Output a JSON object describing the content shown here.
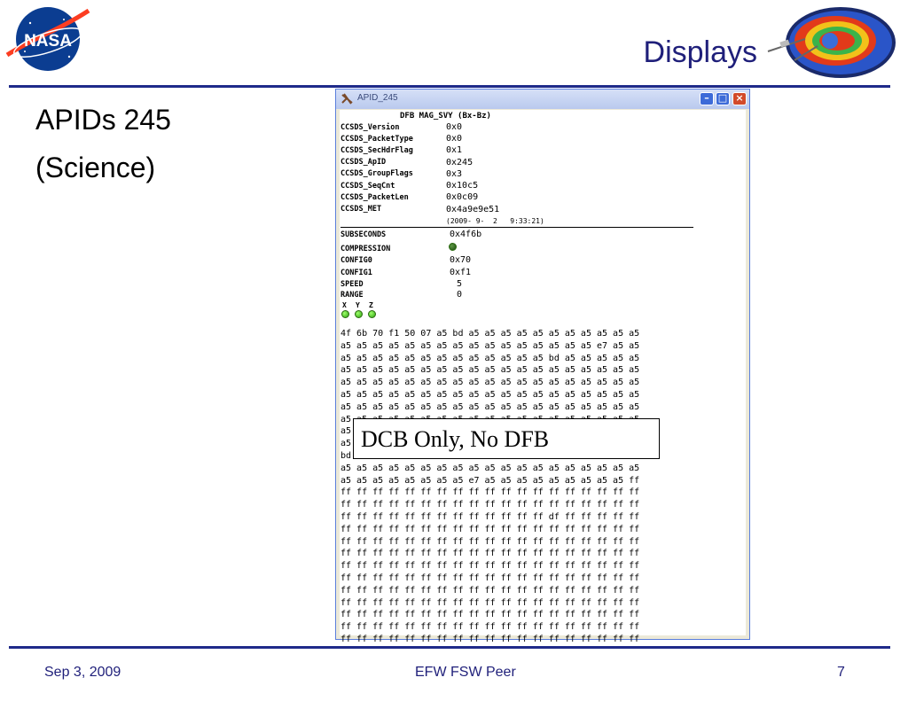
{
  "slide": {
    "title": "Displays",
    "bullets": [
      "APIDs 245",
      "(Science)"
    ],
    "footer": {
      "date": "Sep 3, 2009",
      "center": "EFW FSW Peer",
      "page": "7"
    },
    "logo_text": "NASA"
  },
  "window": {
    "title": "APID_245",
    "header": "DFB MAG_SVY (Bx-Bz)",
    "fields": [
      {
        "label": "CCSDS_Version",
        "value": "0x0"
      },
      {
        "label": "CCSDS_PacketType",
        "value": "0x0"
      },
      {
        "label": "CCSDS_SecHdrFlag",
        "value": "0x1"
      },
      {
        "label": "CCSDS_ApID",
        "value": "0x245"
      },
      {
        "label": "CCSDS_GroupFlags",
        "value": "0x3"
      },
      {
        "label": "CCSDS_SeqCnt",
        "value": "0x10c5"
      },
      {
        "label": "CCSDS_PacketLen",
        "value": "0x0c09"
      },
      {
        "label": "CCSDS_MET",
        "value": "0x4a9e9e51"
      }
    ],
    "met_time": "(2009- 9-  2   9:33:21)",
    "subseconds": {
      "label": "SUBSECONDS",
      "value": "0x4f6b"
    },
    "compression": {
      "label": "COMPRESSION"
    },
    "config0": {
      "label": "CONFIG0",
      "value": "0x70"
    },
    "config1": {
      "label": "CONFIG1",
      "value": "0xf1"
    },
    "speed": {
      "label": "SPEED",
      "value": "5"
    },
    "range": {
      "label": "RANGE",
      "value": "0"
    },
    "axes": [
      "X",
      "Y",
      "Z"
    ],
    "hexdump": "4f 6b 70 f1 50 07 a5 bd a5 a5 a5 a5 a5 a5 a5 a5 a5 a5 a5\na5 a5 a5 a5 a5 a5 a5 a5 a5 a5 a5 a5 a5 a5 a5 a5 e7 a5 a5\na5 a5 a5 a5 a5 a5 a5 a5 a5 a5 a5 a5 a5 bd a5 a5 a5 a5 a5\na5 a5 a5 a5 a5 a5 a5 a5 a5 a5 a5 a5 a5 a5 a5 a5 a5 a5 a5\na5 a5 a5 a5 a5 a5 a5 a5 a5 a5 a5 a5 a5 a5 a5 a5 a5 a5 a5\na5 a5 a5 a5 a5 a5 a5 a5 a5 a5 a5 a5 a5 a5 a5 a5 a5 a5 a5\na5 a5 a5 a5 a5 a5 a5 a5 a5 a5 a5 a5 a5 a5 a5 a5 a5 a5 a5\na5 a5 a5 a5 a5 a5 a5 a5 a5 a5 a5 a5 a5 a5 a5 a5 a5 a5 a5\na5 a5 a5 a5 a5 a5 a5 a5 a5 a5 a5 a5 a5 a5 a5 a5 a5 a5 a5\na5 a5 a5 a5 a5 a5 a5 a5 a5 a5 a5 a5 a5 a5 a5 a5 a5 a5 a5\nbd a5 a5 a5 a5 a5 a5 a5 a5 a5 a5 a5 a5 a5 a5 a5 a5 a5 a5\na5 a5 a5 a5 a5 a5 a5 a5 a5 a5 a5 a5 a5 a5 a5 a5 a5 a5 a5\na5 a5 a5 a5 a5 a5 a5 a5 e7 a5 a5 a5 a5 a5 a5 a5 a5 a5 ff\nff ff ff ff ff ff ff ff ff ff ff ff ff ff ff ff ff ff ff\nff ff ff ff ff ff ff ff ff ff ff ff ff ff ff ff ff ff ff\nff ff ff ff ff ff ff ff ff ff ff ff ff df ff ff ff ff ff\nff ff ff ff ff ff ff ff ff ff ff ff ff ff ff ff ff ff ff\nff ff ff ff ff ff ff ff ff ff ff ff ff ff ff ff ff ff ff\nff ff ff ff ff ff ff ff ff ff ff ff ff ff ff ff ff ff ff\nff ff ff ff ff ff ff ff ff ff ff ff ff ff ff ff ff ff ff\nff ff ff ff ff ff ff ff ff ff ff ff ff ff ff ff ff ff ff\nff ff ff ff ff ff ff ff ff ff ff ff ff ff ff ff ff ff ff\nff ff ff ff ff ff ff ff ff ff ff ff ff ff ff ff ff ff ff\nff ff ff ff ff ff ff ff ff ff ff ff ff ff ff ff ff ff ff\nff ff ff ff ff ff ff ff ff ff ff ff ff ff ff ff ff ff ff\nff ff ff ff ff ff ff ff ff ff ff ff ff ff ff ff ff ff ff",
    "colors": {
      "led_on": "#4cd222",
      "titlebar": "#b9c9ee",
      "close": "#d24a2a"
    }
  },
  "callout": "DCB Only, No DFB",
  "icons": [
    "nasa-logo",
    "orbit-illustration",
    "app-icon",
    "minimize-icon",
    "maximize-icon",
    "close-icon"
  ]
}
